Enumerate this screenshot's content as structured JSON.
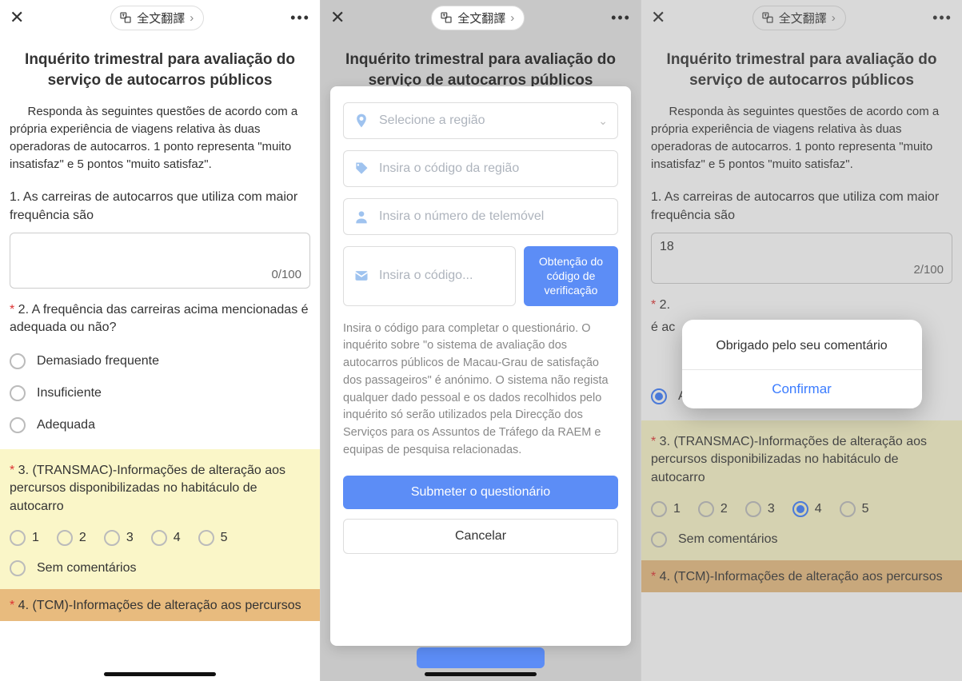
{
  "header": {
    "translate_label": "全文翻譯",
    "translate_chevron": "›"
  },
  "survey": {
    "title": "Inquérito trimestral para avaliação do serviço de autocarros públicos",
    "intro": "Responda às seguintes questões de acordo com a própria experiência de viagens relativa às duas operadoras de autocarros. 1 ponto representa \"muito insatisfaz\" e 5 pontos \"muito satisfaz\".",
    "q1": {
      "text": "1. As carreiras de autocarros que utiliza com maior frequência são",
      "counter_empty": "0/100",
      "value_filled": "18",
      "counter_filled": "2/100"
    },
    "q2": {
      "text": "2. A frequência das carreiras acima mencionadas é adequada ou não?",
      "text_trimmed_a": "2.",
      "text_trimmed_b": "é ac",
      "options": [
        "Demasiado frequente",
        "Insuficiente",
        "Adequada"
      ]
    },
    "q3": {
      "text": "3. (TRANSMAC)-Informações de alteração aos percursos disponibilizadas no habitáculo de autocarro",
      "scale": [
        "1",
        "2",
        "3",
        "4",
        "5"
      ],
      "no_comment": "Sem comentários"
    },
    "q4": {
      "text": "4. (TCM)-Informações de alteração aos percursos"
    }
  },
  "sheet": {
    "region_placeholder": "Selecione a região",
    "region_code_placeholder": "Insira o código da região",
    "phone_placeholder": "Insira o número de telemóvel",
    "code_placeholder": "Insira o código...",
    "get_code_label": "Obtenção do código de verificação",
    "disclaimer": "Insira o código para completar o questionário. O inquérito sobre \"o sistema de avaliação dos autocarros públicos de Macau-Grau de satisfação dos passageiros\" é anónimo. O sistema não regista qualquer dado pessoal e os dados recolhidos pelo inquérito só serão utilizados pela Direcção dos Serviços para os Assuntos de Tráfego da RAEM e equipas de pesquisa relacionadas.",
    "submit_label": "Submeter o questionário",
    "cancel_label": "Cancelar"
  },
  "alert": {
    "message": "Obrigado pelo seu comentário",
    "confirm": "Confirmar"
  }
}
